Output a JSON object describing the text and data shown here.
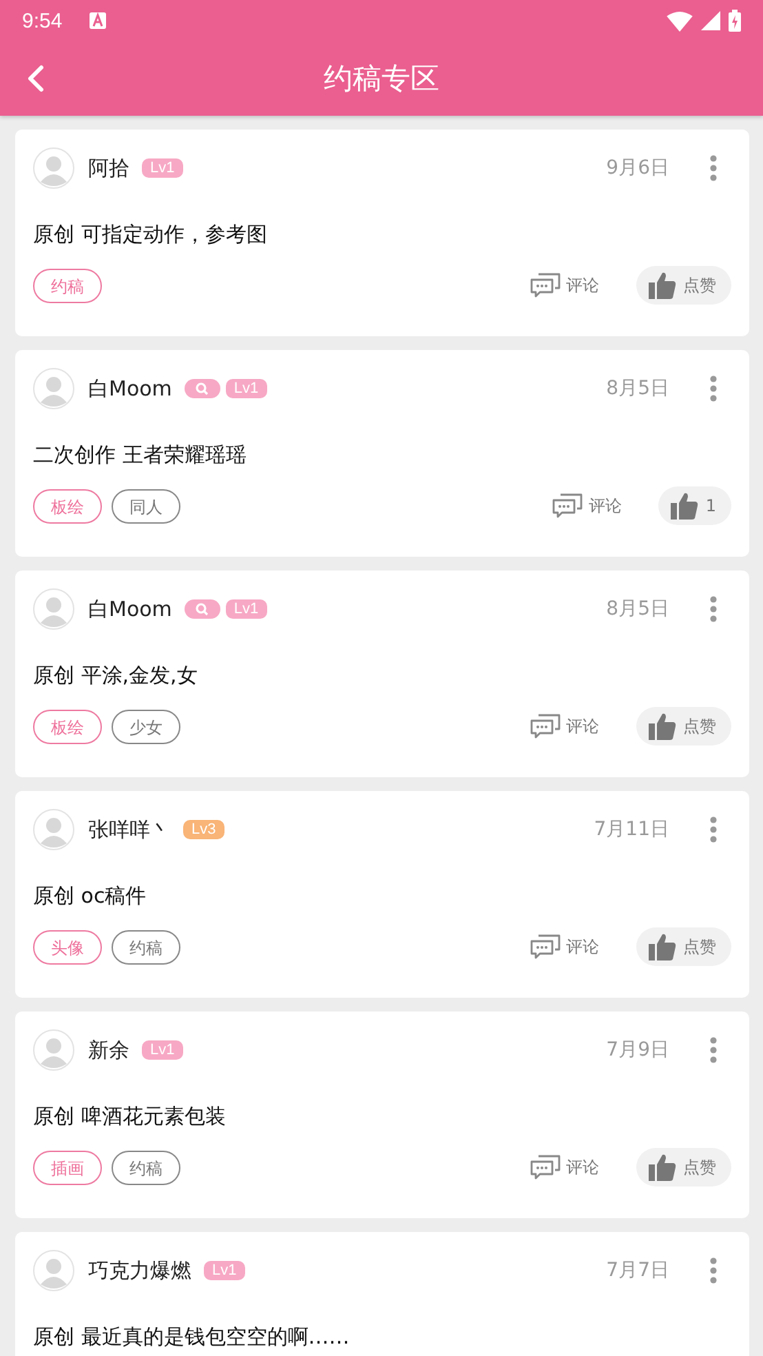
{
  "status_bar": {
    "time": "9:54"
  },
  "app_bar": {
    "title": "约稿专区"
  },
  "posts": [
    {
      "author": "阿拾",
      "verified": false,
      "level": "Lv1",
      "color": "#f7a8c4",
      "date": "9月6日",
      "text": "原创 可指定动作，参考图",
      "tags": [
        {
          "label": "约稿",
          "kind": "primary"
        }
      ],
      "comment": "评论",
      "like": "点赞"
    },
    {
      "author": "白Moom",
      "verified": true,
      "level": "Lv1",
      "color": "#f7a8c4",
      "date": "8月5日",
      "text": "二次创作 王者荣耀瑶瑶",
      "tags": [
        {
          "label": "板绘",
          "kind": "primary"
        },
        {
          "label": "同人",
          "kind": "plain"
        }
      ],
      "comment": "评论",
      "like": "1"
    },
    {
      "author": "白Moom",
      "verified": true,
      "level": "Lv1",
      "color": "#f7a8c4",
      "date": "8月5日",
      "text": "原创 平涂,金发,女",
      "tags": [
        {
          "label": "板绘",
          "kind": "primary"
        },
        {
          "label": "少女",
          "kind": "plain"
        }
      ],
      "comment": "评论",
      "like": "点赞"
    },
    {
      "author": "张咩咩丶",
      "verified": false,
      "level": "Lv3",
      "color": "#f9b477",
      "date": "7月11日",
      "text": "原创 oc稿件",
      "tags": [
        {
          "label": "头像",
          "kind": "primary"
        },
        {
          "label": "约稿",
          "kind": "plain"
        }
      ],
      "comment": "评论",
      "like": "点赞"
    },
    {
      "author": "新余",
      "verified": false,
      "level": "Lv1",
      "color": "#f7a8c4",
      "date": "7月9日",
      "text": "原创 啤酒花元素包装",
      "tags": [
        {
          "label": "插画",
          "kind": "primary"
        },
        {
          "label": "约稿",
          "kind": "plain"
        }
      ],
      "comment": "评论",
      "like": "点赞"
    },
    {
      "author": "巧克力爆燃",
      "verified": false,
      "level": "Lv1",
      "color": "#f7a8c4",
      "date": "7月7日",
      "text": "原创 最近真的是钱包空空的啊……"
    }
  ]
}
